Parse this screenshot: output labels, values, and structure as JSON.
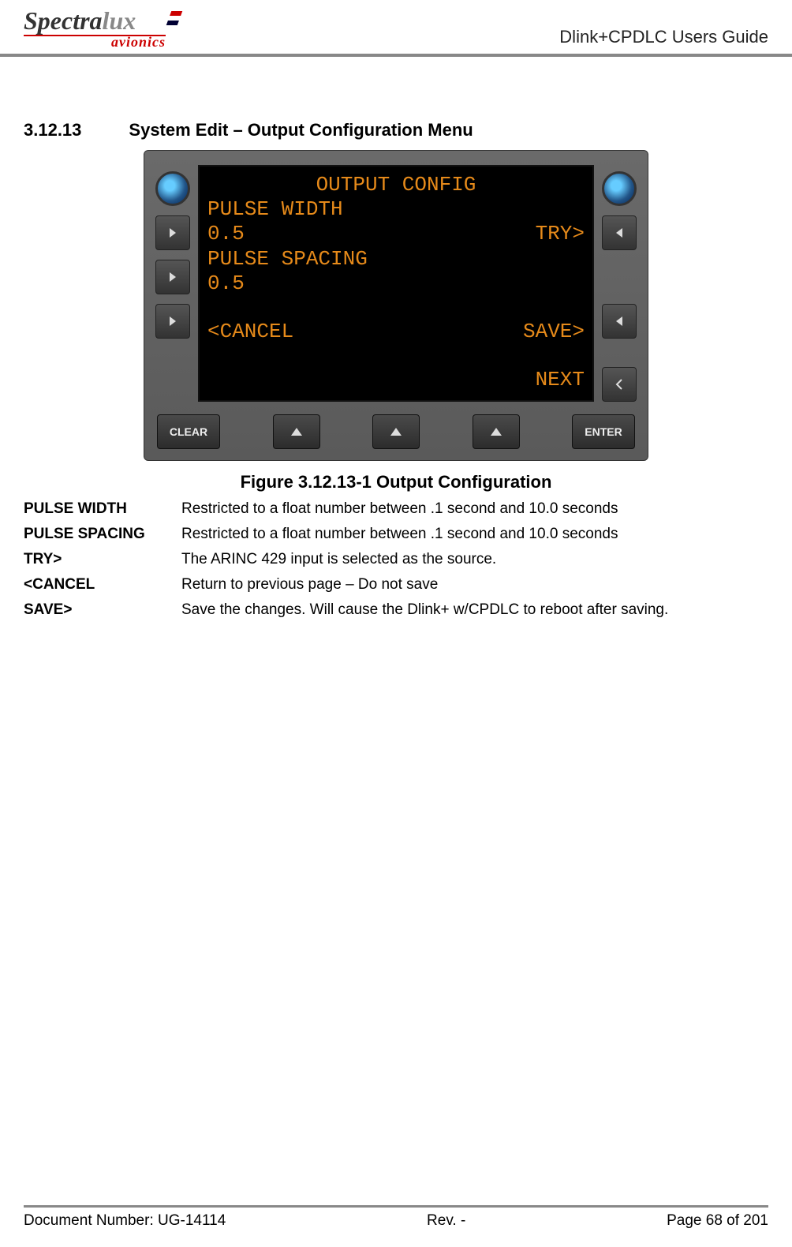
{
  "header": {
    "logo_part1": "Spectra",
    "logo_part2": "lux",
    "logo_sub": "avionics",
    "doc_title": "Dlink+CPDLC Users Guide"
  },
  "section": {
    "number": "3.12.13",
    "title": "System Edit – Output Configuration Menu"
  },
  "device": {
    "screen": {
      "title": "OUTPUT CONFIG",
      "line2_left": "PULSE WIDTH",
      "line3_left": "0.5",
      "line3_right": "TRY>",
      "line4_left": "PULSE SPACING",
      "line5_left": "0.5",
      "line7_left": "<CANCEL",
      "line7_right": "SAVE>",
      "line9_right": "NEXT"
    },
    "bottom": {
      "clear": "CLEAR",
      "enter": "ENTER"
    }
  },
  "figure_caption": "Figure 3.12.13-1 Output Configuration",
  "definitions": [
    {
      "term": "PULSE WIDTH",
      "desc": "Restricted to a float number between .1 second and 10.0 seconds"
    },
    {
      "term": "PULSE SPACING",
      "desc": "Restricted to a float number between .1 second and 10.0 seconds"
    },
    {
      "term": "TRY>",
      "desc": "The ARINC 429 input is selected as the source."
    },
    {
      "term": "<CANCEL",
      "desc": "Return to previous page – Do not save"
    },
    {
      "term": "SAVE>",
      "desc": "Save the changes.  Will cause the Dlink+ w/CPDLC to reboot after saving."
    }
  ],
  "footer": {
    "doc_number": "Document Number:  UG-14114",
    "revision": "Rev. -",
    "page": "Page 68 of 201"
  }
}
